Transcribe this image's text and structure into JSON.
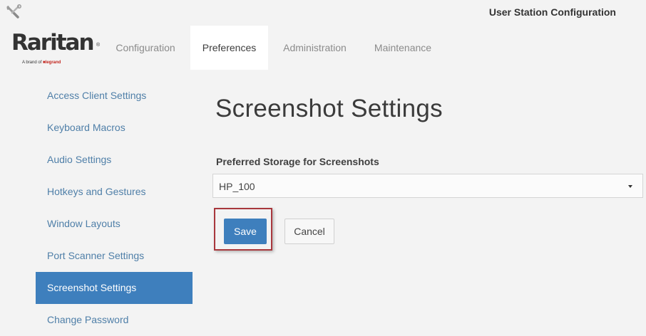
{
  "app": {
    "title": "User Station Configuration",
    "tools_icon": "tools-icon"
  },
  "logo": {
    "name": "Raritan",
    "tagline_prefix": "A brand of",
    "tagline_brand": "legrand",
    "registered_mark": "®"
  },
  "nav": {
    "tabs": [
      {
        "label": "Configuration",
        "active": false
      },
      {
        "label": "Preferences",
        "active": true
      },
      {
        "label": "Administration",
        "active": false
      },
      {
        "label": "Maintenance",
        "active": false
      }
    ]
  },
  "sidebar": {
    "items": [
      {
        "label": "Access Client Settings",
        "active": false
      },
      {
        "label": "Keyboard Macros",
        "active": false
      },
      {
        "label": "Audio Settings",
        "active": false
      },
      {
        "label": "Hotkeys and Gestures",
        "active": false
      },
      {
        "label": "Window Layouts",
        "active": false
      },
      {
        "label": "Port Scanner Settings",
        "active": false
      },
      {
        "label": "Screenshot Settings",
        "active": true
      },
      {
        "label": "Change Password",
        "active": false
      }
    ]
  },
  "main": {
    "title": "Screenshot Settings",
    "storage_label": "Preferred Storage for Screenshots",
    "storage_value": "HP_100",
    "save_label": "Save",
    "cancel_label": "Cancel"
  },
  "colors": {
    "accent": "#3e7fbd",
    "sidebar_link": "#4f7fa8",
    "highlight_border": "#a8373c",
    "brand_red": "#c2231b"
  }
}
